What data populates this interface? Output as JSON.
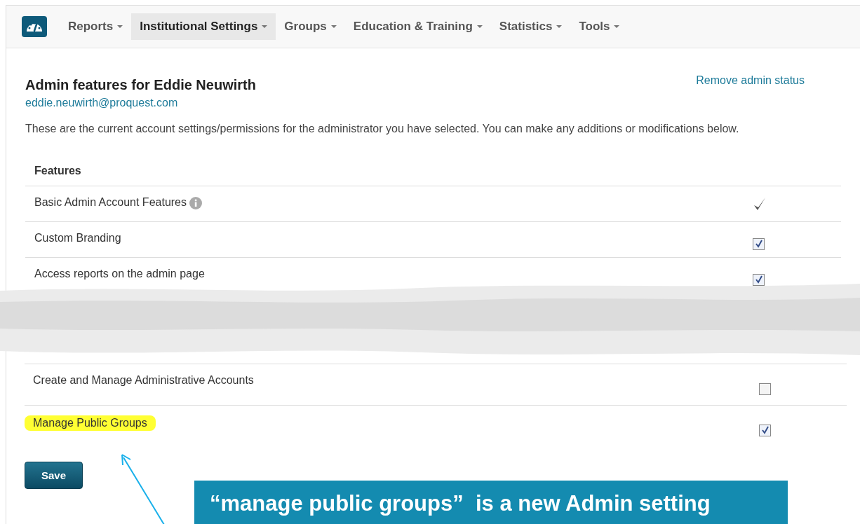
{
  "nav": {
    "items": [
      {
        "label": "Reports",
        "selected": false
      },
      {
        "label": "Institutional Settings",
        "selected": true
      },
      {
        "label": "Groups",
        "selected": false
      },
      {
        "label": "Education & Training",
        "selected": false
      },
      {
        "label": "Statistics",
        "selected": false
      },
      {
        "label": "Tools",
        "selected": false
      }
    ]
  },
  "header": {
    "title": "Admin features for Eddie Neuwirth",
    "email": "eddie.neuwirth@proquest.com",
    "remove_link": "Remove admin status"
  },
  "intro": "These are the current account settings/permissions for the administrator you have selected. You can make any additions or modifications below.",
  "features_heading": "Features",
  "rows_top": [
    {
      "label": "Basic Admin Account Features",
      "kind": "always",
      "info": true,
      "highlighted": false
    },
    {
      "label": "Custom Branding",
      "kind": "checkbox",
      "checked": true,
      "highlighted": false
    },
    {
      "label": "Access reports on the admin page",
      "kind": "checkbox",
      "checked": true,
      "highlighted": false
    }
  ],
  "rows_bottom": [
    {
      "label": "Create and Manage Administrative Accounts",
      "kind": "checkbox",
      "checked": false,
      "highlighted": false
    },
    {
      "label": "Manage Public Groups",
      "kind": "checkbox",
      "checked": true,
      "highlighted": true
    }
  ],
  "save_button": "Save",
  "callout": "“manage public groups”  is a new Admin setting"
}
